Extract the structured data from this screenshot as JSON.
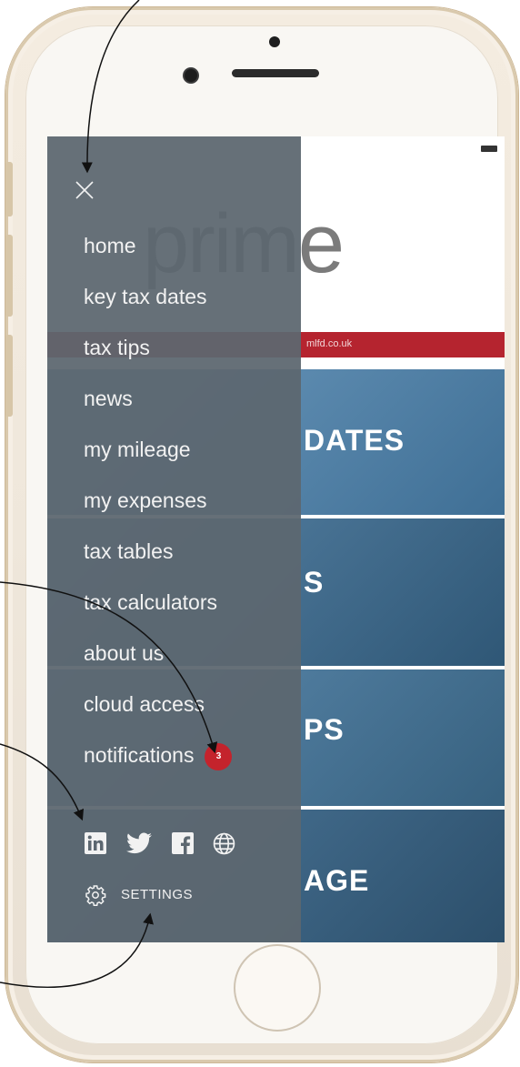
{
  "app": {
    "logo_text": "prime",
    "header_strip_text": "mlfd.co.uk",
    "tiles": [
      {
        "label": "DATES"
      },
      {
        "label": "S"
      },
      {
        "label": "PS"
      },
      {
        "label": "AGE"
      }
    ]
  },
  "menu": {
    "items": [
      {
        "label": "home"
      },
      {
        "label": "key tax dates"
      },
      {
        "label": "tax tips"
      },
      {
        "label": "news"
      },
      {
        "label": "my mileage"
      },
      {
        "label": "my expenses"
      },
      {
        "label": "tax tables"
      },
      {
        "label": "tax calculators"
      },
      {
        "label": "about us"
      },
      {
        "label": "cloud access"
      },
      {
        "label": "notifications"
      }
    ],
    "notification_count": "3",
    "settings_label": "SETTINGS",
    "social_icons": [
      "linkedin-icon",
      "twitter-icon",
      "facebook-icon",
      "globe-icon"
    ]
  },
  "colors": {
    "menu_bg": "#5c6770",
    "badge": "#c4232c",
    "brand_red": "#b5242f",
    "tile_blue": "#4b7ea3"
  }
}
